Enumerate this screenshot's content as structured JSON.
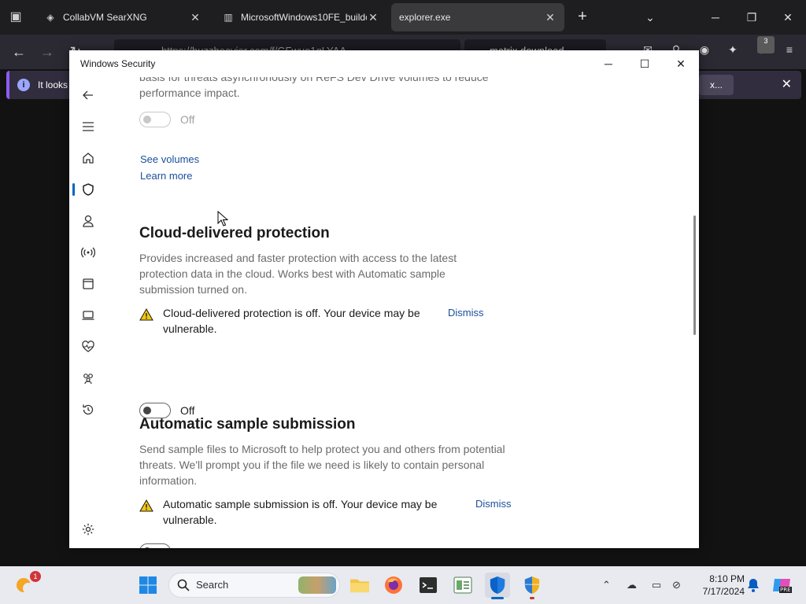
{
  "browser": {
    "tabs": [
      {
        "label": "CollabVM SearXNG",
        "active": false
      },
      {
        "label": "MicrosoftWindows10FE_buildc",
        "active": false
      },
      {
        "label": "explorer.exe",
        "active": true
      }
    ],
    "url": "https://buzzheavier.com/f/GFwuo1qLYAA",
    "search_text": "matrix download",
    "extension_badge": "3",
    "notification": {
      "text": "It looks l",
      "button": "x..."
    }
  },
  "window": {
    "title": "Windows Security",
    "controls": {
      "minimize": "─",
      "maximize": "☐",
      "close": "✕"
    }
  },
  "nav": {
    "items": [
      {
        "name": "back-icon",
        "label": "Back"
      },
      {
        "name": "menu-icon",
        "label": "Menu"
      },
      {
        "name": "home-icon",
        "label": "Home"
      },
      {
        "name": "shield-icon",
        "label": "Virus & threat protection",
        "active": true
      },
      {
        "name": "account-icon",
        "label": "Account protection"
      },
      {
        "name": "network-icon",
        "label": "Firewall & network protection"
      },
      {
        "name": "app-browser-icon",
        "label": "App & browser control"
      },
      {
        "name": "device-icon",
        "label": "Device security"
      },
      {
        "name": "health-icon",
        "label": "Device performance & health"
      },
      {
        "name": "family-icon",
        "label": "Family options"
      },
      {
        "name": "history-icon",
        "label": "Protection history"
      },
      {
        "name": "settings-icon",
        "label": "Settings"
      }
    ]
  },
  "content": {
    "top_desc_line1": "basis for threats asynchronously on ReFS Dev Drive volumes to reduce",
    "top_desc_line2": "performance impact.",
    "dev_drive_toggle": {
      "state": "Off",
      "enabled": false
    },
    "see_volumes": "See volumes",
    "learn_more": "Learn more",
    "cloud": {
      "title": "Cloud-delivered protection",
      "desc": "Provides increased and faster protection with access to the latest protection data in the cloud. Works best with Automatic sample submission turned on.",
      "warning": "Cloud-delivered protection is off. Your device may be vulnerable.",
      "dismiss": "Dismiss",
      "toggle_state": "Off"
    },
    "sample": {
      "title": "Automatic sample submission",
      "desc": "Send sample files to Microsoft to help protect you and others from potential threats. We'll prompt you if the file we need is likely to contain personal information.",
      "warning": "Automatic sample submission is off. Your device may be vulnerable.",
      "dismiss": "Dismiss",
      "toggle_state": "Off"
    }
  },
  "taskbar": {
    "weather_badge": "1",
    "search_placeholder": "Search",
    "apps": [
      {
        "name": "file-explorer-icon"
      },
      {
        "name": "firefox-icon"
      },
      {
        "name": "terminal-icon"
      },
      {
        "name": "task-manager-icon"
      },
      {
        "name": "windows-security-icon",
        "active": true
      },
      {
        "name": "uac-shield-icon",
        "running": true
      }
    ],
    "time": "8:10 PM",
    "date": "7/17/2024",
    "copilot_label": "PRE"
  }
}
